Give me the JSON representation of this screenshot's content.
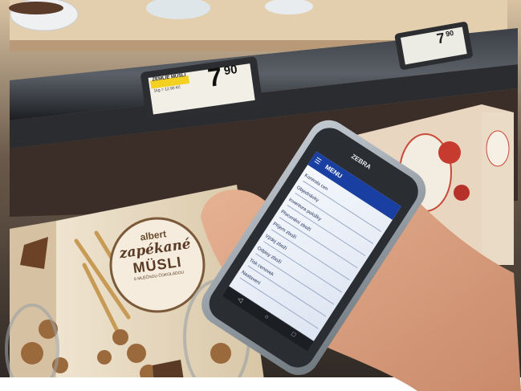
{
  "shelf_tags": [
    {
      "badge": "ZEMLIE MUSLI",
      "price_main": "7",
      "price_cents": "90",
      "small_text": "1kg = 12.90 Kč"
    },
    {
      "badge": "",
      "price_main": "7",
      "price_cents": "90",
      "small_text": ""
    }
  ],
  "product": {
    "brand": "albert",
    "name_line1": "zapékané",
    "name_line2": "MÜSLI",
    "subtitle": "S MLÉČNOU ČOKOLÁDOU"
  },
  "device": {
    "brand": "ZEBRA",
    "app_header": "MENU",
    "menu_items": [
      "Kontrola cen",
      "Objednávky",
      "Inventura položky",
      "Přecenění zboží",
      "Příjem zboží",
      "Výdej zboží",
      "Odpisy zboží",
      "Tisk cenovek",
      "Nastavení"
    ]
  },
  "colors": {
    "app_bar": "#1a3fa3",
    "screen_bg": "#f3f6fb",
    "tag_yellow": "#f4d020",
    "device_frame": "#9aa3ab"
  }
}
